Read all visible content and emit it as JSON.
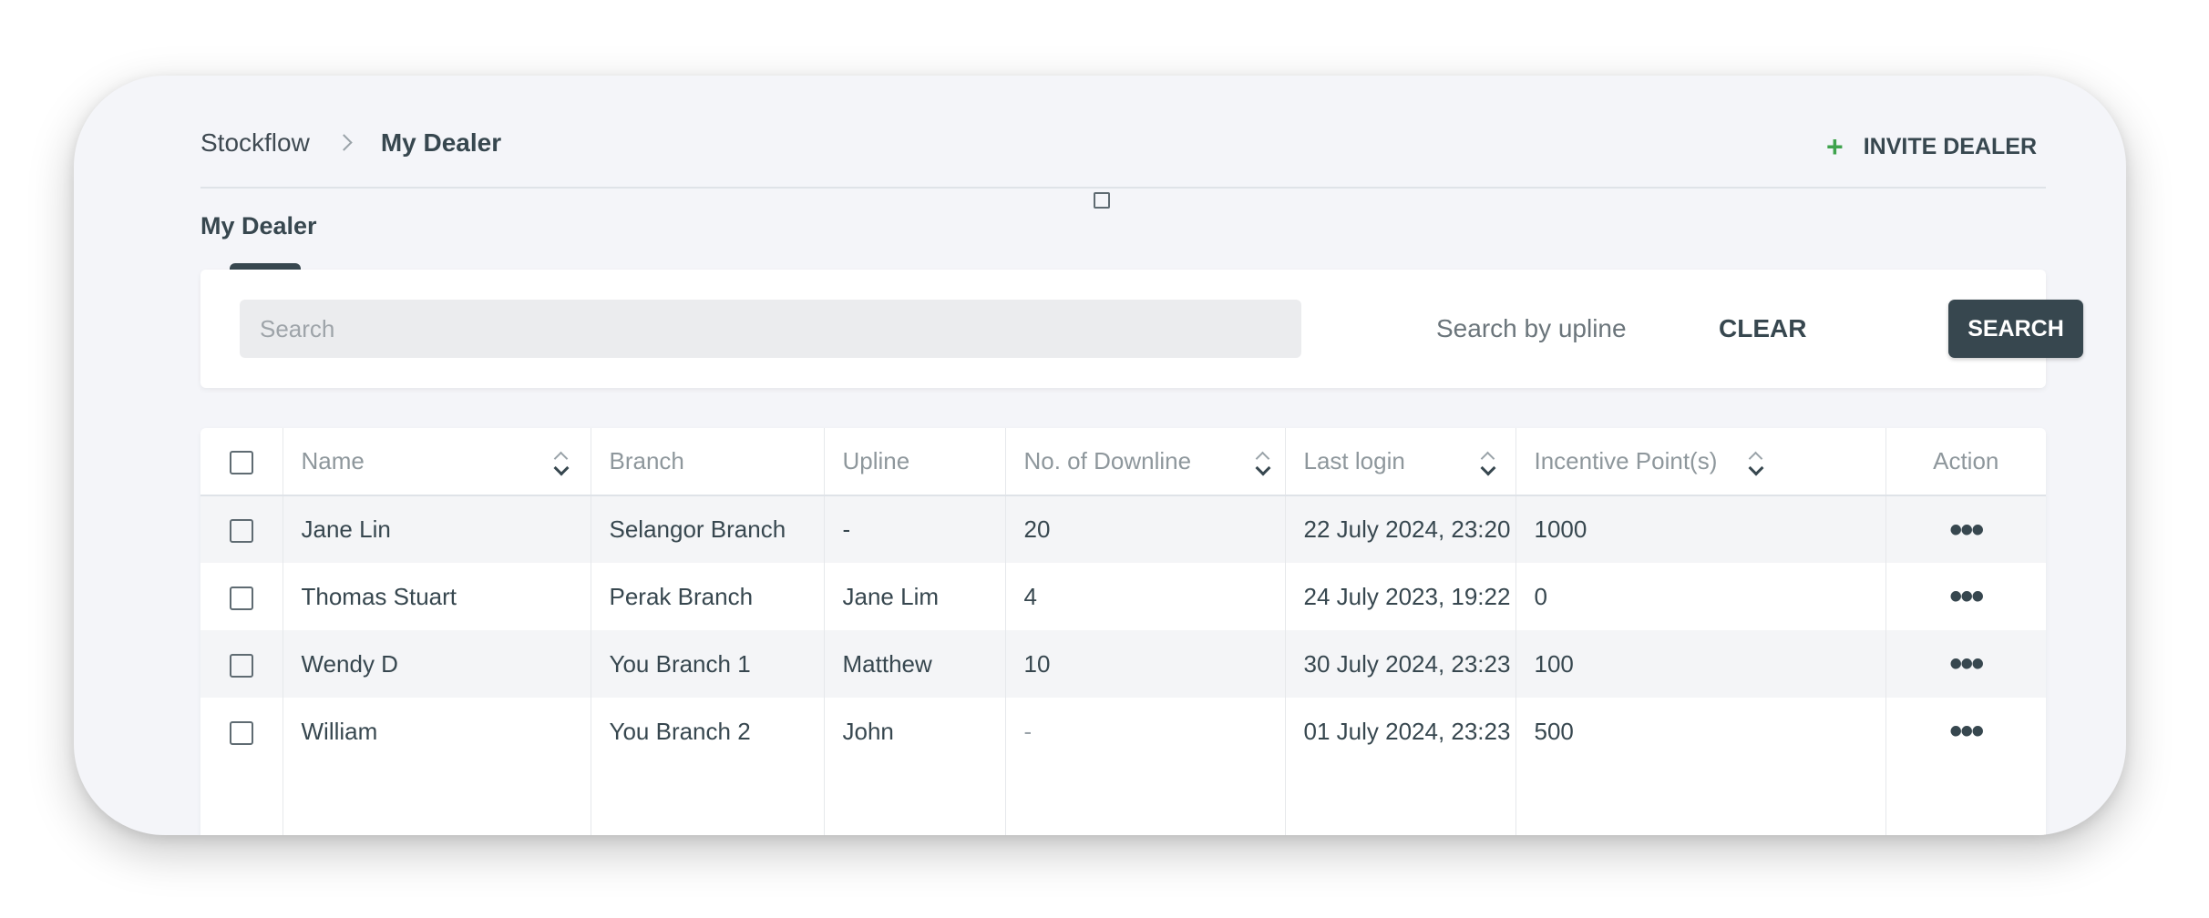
{
  "breadcrumb": {
    "root": "Stockflow",
    "current": "My Dealer"
  },
  "header": {
    "invite_icon": "+",
    "invite_label": "INVITE DEALER"
  },
  "section_title": "My Dealer",
  "search": {
    "placeholder": "Search",
    "upline_placeholder": "Search by upline",
    "clear_label": "CLEAR",
    "search_label": "SEARCH"
  },
  "table": {
    "columns": {
      "name": "Name",
      "branch": "Branch",
      "upline": "Upline",
      "downline": "No. of Downline",
      "last_login": "Last login",
      "points": "Incentive Point(s)",
      "action": "Action"
    },
    "rows": [
      {
        "name": "Jane Lin",
        "branch": "Selangor Branch",
        "upline": "-",
        "downline": "20",
        "last_login": "22 July 2024, 23:20",
        "points": "1000"
      },
      {
        "name": "Thomas Stuart",
        "branch": "Perak Branch",
        "upline": "Jane Lim",
        "downline": "4",
        "last_login": "24 July 2023, 19:22",
        "points": "0"
      },
      {
        "name": "Wendy D",
        "branch": "You Branch 1",
        "upline": "Matthew",
        "downline": "10",
        "last_login": "30 July 2024, 23:23",
        "points": "100"
      },
      {
        "name": "William",
        "branch": "You Branch 2",
        "upline": "John",
        "downline": "-",
        "last_login": "01 July 2024, 23:23",
        "points": "500"
      }
    ],
    "action_icon": "•••"
  },
  "colors": {
    "primary": "#37474f",
    "accent_green": "#3fa34d",
    "background": "#f4f5f9"
  }
}
